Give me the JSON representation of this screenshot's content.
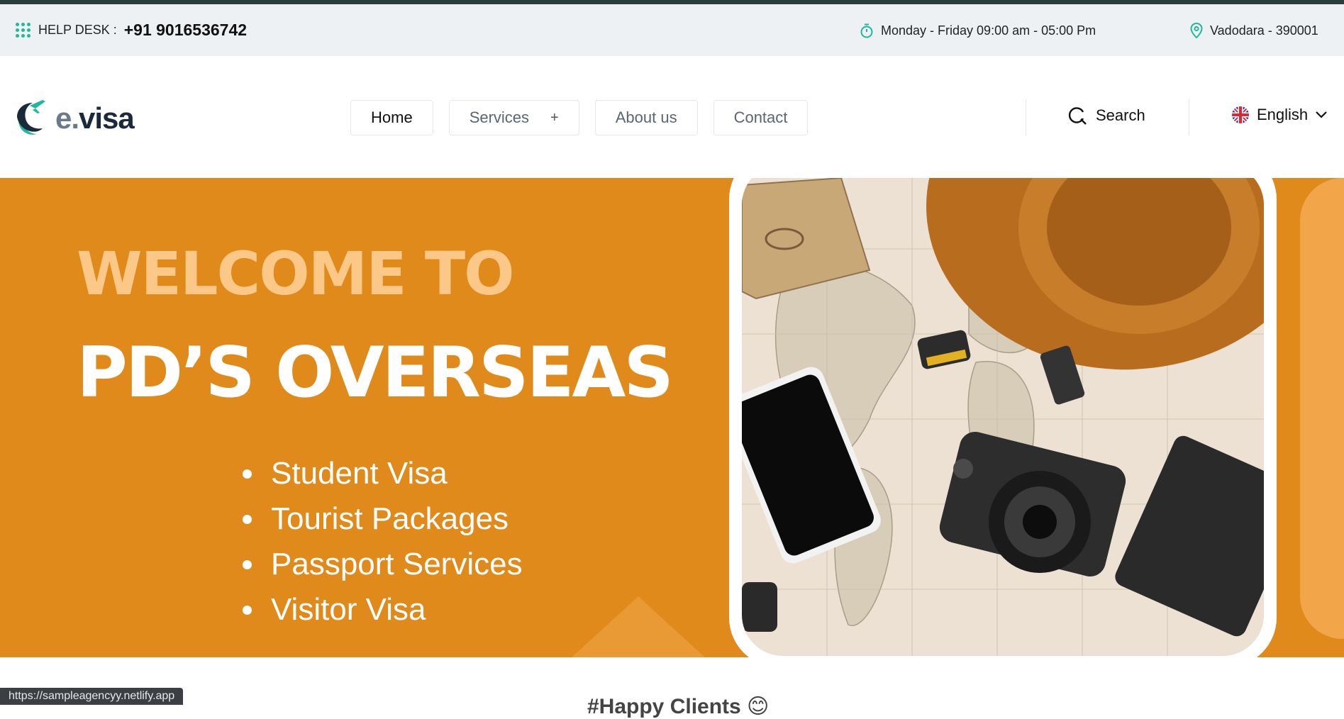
{
  "topbar": {
    "helpdesk_label": "HELP DESK :",
    "helpdesk_phone": "+91 9016536742",
    "hours": "Monday - Friday 09:00 am - 05:00 Pm",
    "location": "Vadodara - 390001"
  },
  "nav": {
    "logo_e": "e.",
    "logo_visa": "visa",
    "items": [
      {
        "label": "Home"
      },
      {
        "label": "Services"
      },
      {
        "label": "About us"
      },
      {
        "label": "Contact"
      }
    ],
    "services_plus": "+",
    "search_label": "Search",
    "language": "English"
  },
  "hero": {
    "welcome": "WELCOME TO",
    "brand": "PD’S OVERSEAS",
    "services": [
      "Student Visa",
      "Tourist Packages",
      "Passport Services",
      "Visitor Visa"
    ]
  },
  "below": {
    "happy_clients": "#Happy Clients 😊"
  },
  "status": {
    "url": "https://sampleagencyy.netlify.app"
  },
  "colors": {
    "accent": "#1fb89a",
    "hero_bg": "#df8a1a",
    "welcome_text": "#fcc888"
  }
}
